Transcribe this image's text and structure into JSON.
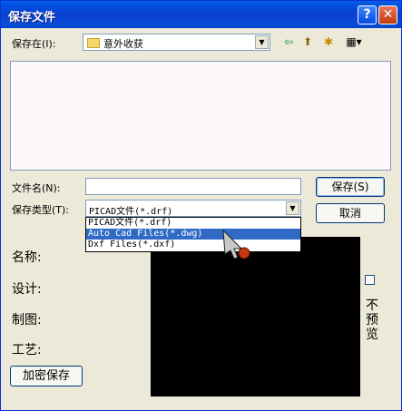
{
  "window": {
    "title": "保存文件",
    "help_glyph": "?",
    "close_glyph": "✕"
  },
  "save_in": {
    "label": "保存在(I):",
    "value": "意外收获"
  },
  "toolbar": {
    "back_glyph": "⇦",
    "up_glyph": "⬆",
    "new_folder_glyph": "✱",
    "view_glyph": "▦▾"
  },
  "file_name": {
    "label": "文件名(N):",
    "value": ""
  },
  "save_type": {
    "label": "保存类型(T):",
    "value": "PICAD文件(*.drf)",
    "options": [
      "PICAD文件(*.drf)",
      "Auto Cad Files(*.dwg)",
      "Dxf Files(*.dxf)"
    ],
    "highlighted_index": 1
  },
  "buttons": {
    "save": "保存(S)",
    "cancel": "取消",
    "encrypt_save": "加密保存"
  },
  "info": {
    "name": "名称:",
    "design": "设计:",
    "draft": "制图:",
    "craft": "工艺:"
  },
  "preview": {
    "no_preview_label": "不预览"
  }
}
